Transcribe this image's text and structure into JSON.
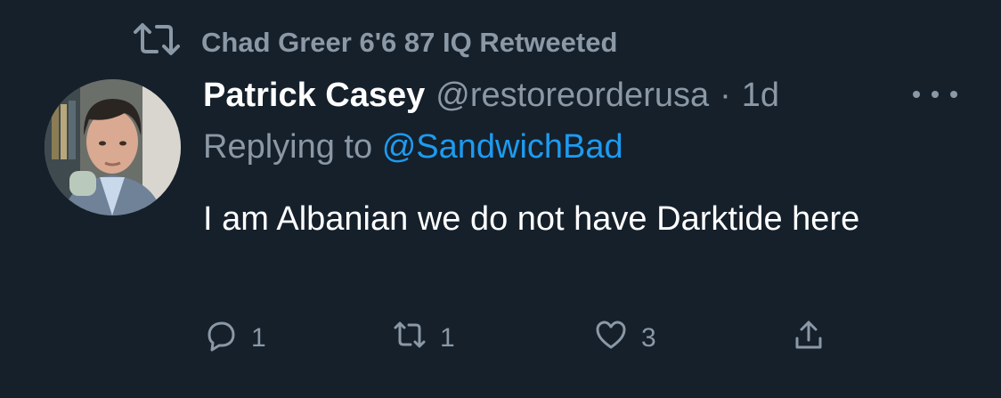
{
  "retweet_banner": {
    "icon": "retweet-icon",
    "text": "Chad Greer 6'6 87 IQ Retweeted"
  },
  "author": {
    "display_name": "Patrick Casey",
    "handle": "@restoreorderusa",
    "separator": "·",
    "timestamp": "1d"
  },
  "reply": {
    "prefix": "Replying to",
    "mention": "@SandwichBad"
  },
  "tweet": {
    "text": "I am Albanian we do not have Darktide here"
  },
  "actions": {
    "reply_count": "1",
    "retweet_count": "1",
    "like_count": "3"
  },
  "colors": {
    "background": "#15202b",
    "muted": "#8b98a5",
    "link": "#1d9bf0",
    "text": "#ffffff"
  }
}
